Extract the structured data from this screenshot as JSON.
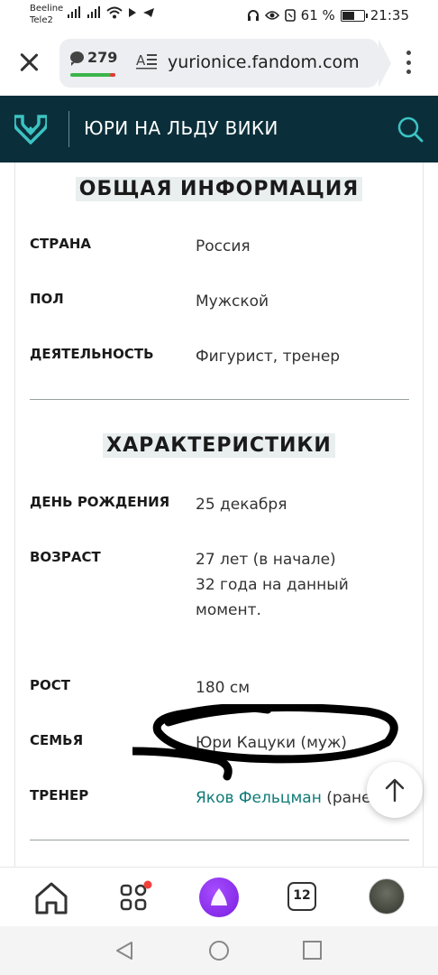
{
  "status_bar": {
    "carrier_1": "Beeline",
    "carrier_2": "Tele2",
    "battery_percent": "61 %",
    "battery_level": 0.61,
    "time": "21:35"
  },
  "browser": {
    "comment_count": "279",
    "url": "yurionice.fandom.com",
    "reader_icon_text": "A☰"
  },
  "wiki_header": {
    "title": "ЮРИ НА ЛЬДУ ВИКИ"
  },
  "infobox": {
    "general_title": "ОБЩАЯ ИНФОРМАЦИЯ",
    "general_rows": [
      {
        "label": "СТРАНА",
        "value": "Россия"
      },
      {
        "label": "ПОЛ",
        "value": "Мужской"
      },
      {
        "label": "ДЕЯТЕЛЬНОСТЬ",
        "value": "Фигурист, тренер"
      }
    ],
    "traits_title": "ХАРАКТЕРИСТИКИ",
    "birthday": {
      "label": "ДЕНЬ РОЖДЕНИЯ",
      "value": "25 декабря"
    },
    "age": {
      "label": "ВОЗРАСТ",
      "line1": "27 лет (в начале)",
      "line2": "32 года на данный",
      "line3": "момент."
    },
    "height": {
      "label": "РОСТ",
      "value": "180 см"
    },
    "family": {
      "label": "СЕМЬЯ",
      "value": "Юри Кацуки (муж)"
    },
    "coach": {
      "label": "ТРЕНЕР",
      "link": "Яков Фельцман",
      "rest": " (ране"
    }
  },
  "bottom_nav": {
    "tab_count": "12"
  },
  "colors": {
    "header_bg": "#0b2f3a",
    "accent_teal": "#3cc3c3",
    "link": "#0f7b77",
    "alice_purple": "#8a2be2"
  }
}
